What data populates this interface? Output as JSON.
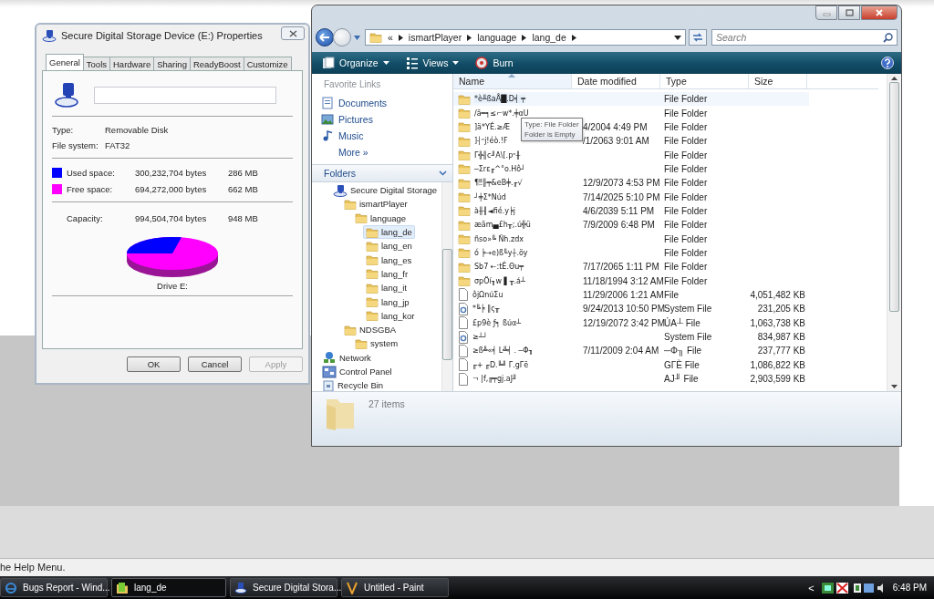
{
  "properties_dialog": {
    "title": "Secure Digital Storage Device (E:) Properties",
    "tabs": [
      {
        "label": "General",
        "selected": true
      },
      {
        "label": "Tools",
        "selected": false
      },
      {
        "label": "Hardware",
        "selected": false
      },
      {
        "label": "Sharing",
        "selected": false
      },
      {
        "label": "ReadyBoost",
        "selected": false
      },
      {
        "label": "Customize",
        "selected": false
      }
    ],
    "info": [
      {
        "label": "Type:",
        "value": "Removable Disk"
      },
      {
        "label": "File system:",
        "value": "FAT32"
      }
    ],
    "space": [
      {
        "label": "Used space:",
        "bytes": "300,232,704 bytes",
        "size": "286 MB",
        "color": "#0000ff"
      },
      {
        "label": "Free space:",
        "bytes": "694,272,000 bytes",
        "size": "662 MB",
        "color": "#ff00ff"
      }
    ],
    "capacity": {
      "label": "Capacity:",
      "bytes": "994,504,704 bytes",
      "size": "948 MB"
    },
    "drive_label": "Drive E:",
    "buttons": [
      {
        "label": "OK",
        "disabled": false
      },
      {
        "label": "Cancel",
        "disabled": false
      },
      {
        "label": "Apply",
        "disabled": true
      }
    ]
  },
  "explorer": {
    "breadcrumb": {
      "overflow": "«",
      "crumbs": [
        "ismartPlayer",
        "language",
        "lang_de"
      ]
    },
    "search": {
      "placeholder": "Search"
    },
    "toolbar": [
      {
        "label": "Organize",
        "dropdown": true
      },
      {
        "label": "Views",
        "dropdown": true
      },
      {
        "label": "Burn",
        "dropdown": false
      }
    ],
    "favorite_links": {
      "header": "Favorite Links",
      "items": [
        "Documents",
        "Pictures",
        "Music"
      ],
      "more": "More »"
    },
    "folders_header": "Folders",
    "tree": [
      {
        "label": "Secure Digital Storage",
        "kind": "drive",
        "selected": false,
        "children": [
          {
            "label": "ismartPlayer",
            "kind": "folder",
            "selected": false,
            "children": [
              {
                "label": "language",
                "kind": "folder",
                "selected": false,
                "children": [
                  {
                    "label": "lang_de",
                    "kind": "folder",
                    "selected": true
                  },
                  {
                    "label": "lang_en",
                    "kind": "folder",
                    "selected": false
                  },
                  {
                    "label": "lang_es",
                    "kind": "folder",
                    "selected": false
                  },
                  {
                    "label": "lang_fr",
                    "kind": "folder",
                    "selected": false
                  },
                  {
                    "label": "lang_it",
                    "kind": "folder",
                    "selected": false
                  },
                  {
                    "label": "lang_jp",
                    "kind": "folder",
                    "selected": false
                  },
                  {
                    "label": "lang_kor",
                    "kind": "folder",
                    "selected": false
                  }
                ]
              }
            ]
          },
          {
            "label": "NDSGBA",
            "kind": "folder",
            "selected": false,
            "children": [
              {
                "label": "system",
                "kind": "folder",
                "selected": false
              }
            ]
          }
        ]
      },
      {
        "label": "Network",
        "kind": "network",
        "selected": false
      },
      {
        "label": "Control Panel",
        "kind": "control-panel",
        "selected": false
      },
      {
        "label": "Recycle Bin",
        "kind": "recycle-bin",
        "selected": false
      }
    ],
    "columns": [
      {
        "label": "Name",
        "sorted": true
      },
      {
        "label": "Date modified",
        "sorted": false
      },
      {
        "label": "Type",
        "sorted": false
      },
      {
        "label": "Size",
        "sorted": false
      }
    ],
    "rows": [
      {
        "kind": "folder",
        "name": "*è╨ßaÅ█.D╡ ╤",
        "date": "",
        "type": "File Folder",
        "size": "",
        "hovered": true
      },
      {
        "kind": "folder",
        "name": "/ä═╕≤⌐w*.╪αU",
        "date": "",
        "type": "File Folder",
        "size": "",
        "hovered": false
      },
      {
        "kind": "folder",
        "name": "]ä*YÉ.≥Æ",
        "date": "4/2004 4:49 PM",
        "type": "File Folder",
        "size": "",
        "hovered": false
      },
      {
        "kind": "folder",
        "name": "]┤ⁿj!éò.!F",
        "date": "/1/2063 9:01 AM",
        "type": "File Folder",
        "size": "",
        "hovered": false
      },
      {
        "kind": "folder",
        "name": "Γ╬╢c╜A\\[.pⁿ╫",
        "date": "",
        "type": "File Folder",
        "size": "",
        "hovered": false
      },
      {
        "kind": "folder",
        "name": "─Σrε╓^°o.Hô┘",
        "date": "",
        "type": "File Folder",
        "size": "",
        "hovered": false
      },
      {
        "kind": "folder",
        "name": "¶‼╟╤&eB╪.╓√",
        "date": "12/9/2073 4:53 PM",
        "type": "File Folder",
        "size": "",
        "hovered": false
      },
      {
        "kind": "folder",
        "name": "┘╪Σ*Núd",
        "date": "7/14/2025 5:10 PM",
        "type": "File Folder",
        "size": "",
        "hovered": false
      },
      {
        "kind": "folder",
        "name": "à╫╢◄fié.y╞j",
        "date": "4/6/2039 5:11 PM",
        "type": "File Folder",
        "size": "",
        "hovered": false
      },
      {
        "kind": "folder",
        "name": "æäm▄£h╥;.ú╬ü",
        "date": "7/9/2009 6:48 PM",
        "type": "File Folder",
        "size": "",
        "hovered": false
      },
      {
        "kind": "folder",
        "name": "ñso»╚ Ñh.zdx",
        "date": "",
        "type": "File Folder",
        "size": "",
        "hovered": false
      },
      {
        "kind": "folder",
        "name": "ó ╞→e)ß╙y┼.öy",
        "date": "",
        "type": "File Folder",
        "size": "",
        "hovered": false
      },
      {
        "kind": "folder",
        "name": "Sb7 ←:tÉ.Θu╤",
        "date": "7/17/2065 1:11 PM",
        "type": "File Folder",
        "size": "",
        "hovered": false
      },
      {
        "kind": "folder",
        "name": "σpÖí╖w ▌╥.á┴",
        "date": "11/18/1994 3:12 AM",
        "type": "File Folder",
        "size": "",
        "hovered": false
      },
      {
        "kind": "file",
        "name": "ôjΩnúΣu",
        "date": "11/29/2006 1:21 AM",
        "type": "File",
        "size": "4,051,482 KB",
        "hovered": false
      },
      {
        "kind": "system",
        "name": "*╚╞ ‖ς╥",
        "date": "9/24/2013 10:50 PM",
        "type": "System File",
        "size": "231,205 KB",
        "hovered": false
      },
      {
        "kind": "file",
        "name": "£p9è ƒ╕ ßúα┴",
        "date": "12/19/2072 3:42 PM",
        "type": "ÚA┴ File",
        "size": "1,063,738 KB",
        "hovered": false
      },
      {
        "kind": "system",
        "name": "≥┴┘",
        "date": "",
        "type": "System File",
        "size": "834,987 KB",
        "hovered": false
      },
      {
        "kind": "file",
        "name": "≥ß╩«╡ L╩╡ . ─Φ╖",
        "date": "7/11/2009 2:04 AM",
        "type": "─Φ╖ File",
        "size": "237,777 KB",
        "hovered": false
      },
      {
        "kind": "file",
        "name": "╓+ ╓D.╚╝ Γ.gΓë",
        "date": "",
        "type": "GΓÈ File",
        "size": "1,086,822 KB",
        "hovered": false
      },
      {
        "kind": "file",
        "name": "¬ |f,╔╤gj.aJ╜",
        "date": "",
        "type": "AJ╜ File",
        "size": "2,903,599 KB",
        "hovered": false
      }
    ],
    "tooltip": [
      "Type: File Folder",
      "Folder is Empty"
    ],
    "item_count": "27 items"
  },
  "status_text": "he Help Menu.",
  "taskbar": {
    "tasks": [
      {
        "label": "Bugs Report - Wind...",
        "selected": false
      },
      {
        "label": "lang_de",
        "selected": true
      },
      {
        "label": "Secure Digital Stora...",
        "selected": false
      },
      {
        "label": "Untitled - Paint",
        "selected": false
      }
    ],
    "tray_chevron": "<",
    "clock": "6:48 PM"
  }
}
